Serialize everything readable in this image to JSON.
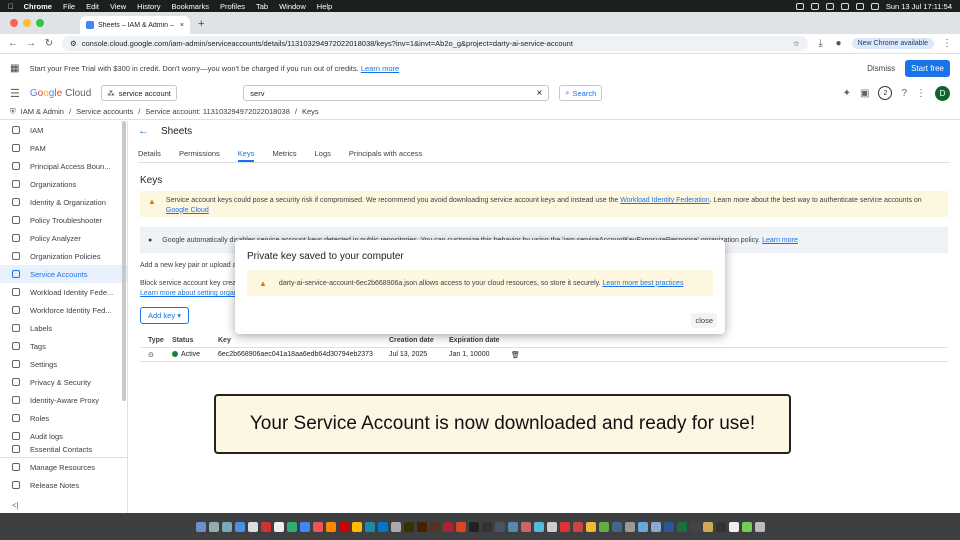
{
  "macbar": {
    "apple": "",
    "menus": [
      "Chrome",
      "File",
      "Edit",
      "View",
      "History",
      "Bookmarks",
      "Profiles",
      "Tab",
      "Window",
      "Help"
    ],
    "datetime": "Sun 13 Jul  17:11:54"
  },
  "browser": {
    "tab_title": "Sheets – IAM & Admin – serv",
    "url": "console.cloud.google.com/iam-admin/serviceaccounts/details/113103294972022018038/keys?inv=1&invt=Ab2o_g&project=darty-ai-service-account",
    "update_label": "New Chrome available"
  },
  "trial": {
    "text": "Start your Free Trial with $300 in credit. Don't worry—you won't be charged if you run out of credits.",
    "link": "Learn more",
    "dismiss": "Dismiss",
    "start": "Start free"
  },
  "header": {
    "logo_g": [
      "G",
      "o",
      "o",
      "g",
      "l",
      "e"
    ],
    "logo_cloud": "Cloud",
    "project": "service account",
    "search_value": "serv",
    "search_button": "Search",
    "notif_count": "2",
    "avatar": "D"
  },
  "breadcrumb": {
    "items": [
      "IAM & Admin",
      "/",
      "Service accounts",
      "/",
      "Service account: 113103294972022018038",
      "/",
      "Keys"
    ]
  },
  "sidebar": {
    "items": [
      {
        "label": "IAM"
      },
      {
        "label": "PAM"
      },
      {
        "label": "Principal Access Boun..."
      },
      {
        "label": "Organizations"
      },
      {
        "label": "Identity & Organization"
      },
      {
        "label": "Policy Troubleshooter"
      },
      {
        "label": "Policy Analyzer"
      },
      {
        "label": "Organization Policies"
      },
      {
        "label": "Service Accounts"
      },
      {
        "label": "Workload Identity Fede..."
      },
      {
        "label": "Workforce Identity Fed..."
      },
      {
        "label": "Labels"
      },
      {
        "label": "Tags"
      },
      {
        "label": "Settings"
      },
      {
        "label": "Privacy & Security"
      },
      {
        "label": "Identity-Aware Proxy"
      },
      {
        "label": "Roles"
      },
      {
        "label": "Audit logs"
      },
      {
        "label": "Essential Contacts"
      }
    ],
    "bottom": [
      "Manage Resources",
      "Release Notes"
    ],
    "collapse": "<|"
  },
  "page": {
    "title": "Sheets",
    "tabs": [
      "Details",
      "Permissions",
      "Keys",
      "Metrics",
      "Logs",
      "Principals with access"
    ],
    "section": "Keys",
    "warning": "Service account keys could pose a security risk if compromised. We recommend you avoid downloading service account keys and instead use the",
    "warning_link1": "Workload Identity Federation",
    "warning_mid": ". Learn more about the best way to authenticate service accounts on",
    "warning_link2": "Google Cloud",
    "info": "Google automatically disables service account keys detected in public repositories. You can customize this behavior by using the 'iam.serviceAccountKeyExposureResponse' organization policy.",
    "info_link": "Learn more",
    "add_text": "Add a new key pair or upload a",
    "block_text": "Block service account key crea",
    "block_link": "Learn more about setting organ",
    "add_key": "Add key"
  },
  "keys_table": {
    "headers": [
      "Type",
      "Status",
      "Key",
      "Creation date",
      "Expiration date",
      ""
    ],
    "rows": [
      {
        "status": "Active",
        "key": "6ec2b668906aec041a18aa6edb64d30794eb2373",
        "created": "Jul 13, 2025",
        "expires": "Jan 1, 10000"
      }
    ]
  },
  "modal": {
    "title": "Private key saved to your computer",
    "message": "darty-ai-service-account-6ec2b668906a.json allows access to your cloud resources, so store it securely.",
    "link": "Learn more best practices",
    "close": "close"
  },
  "caption": "Your Service Account is now downloaded and ready for use!",
  "colors": {
    "accent": "#1a73e8",
    "warning_bg": "#fef7e0",
    "active_green": "#188038",
    "caption_bg": "#fdf6e3"
  }
}
